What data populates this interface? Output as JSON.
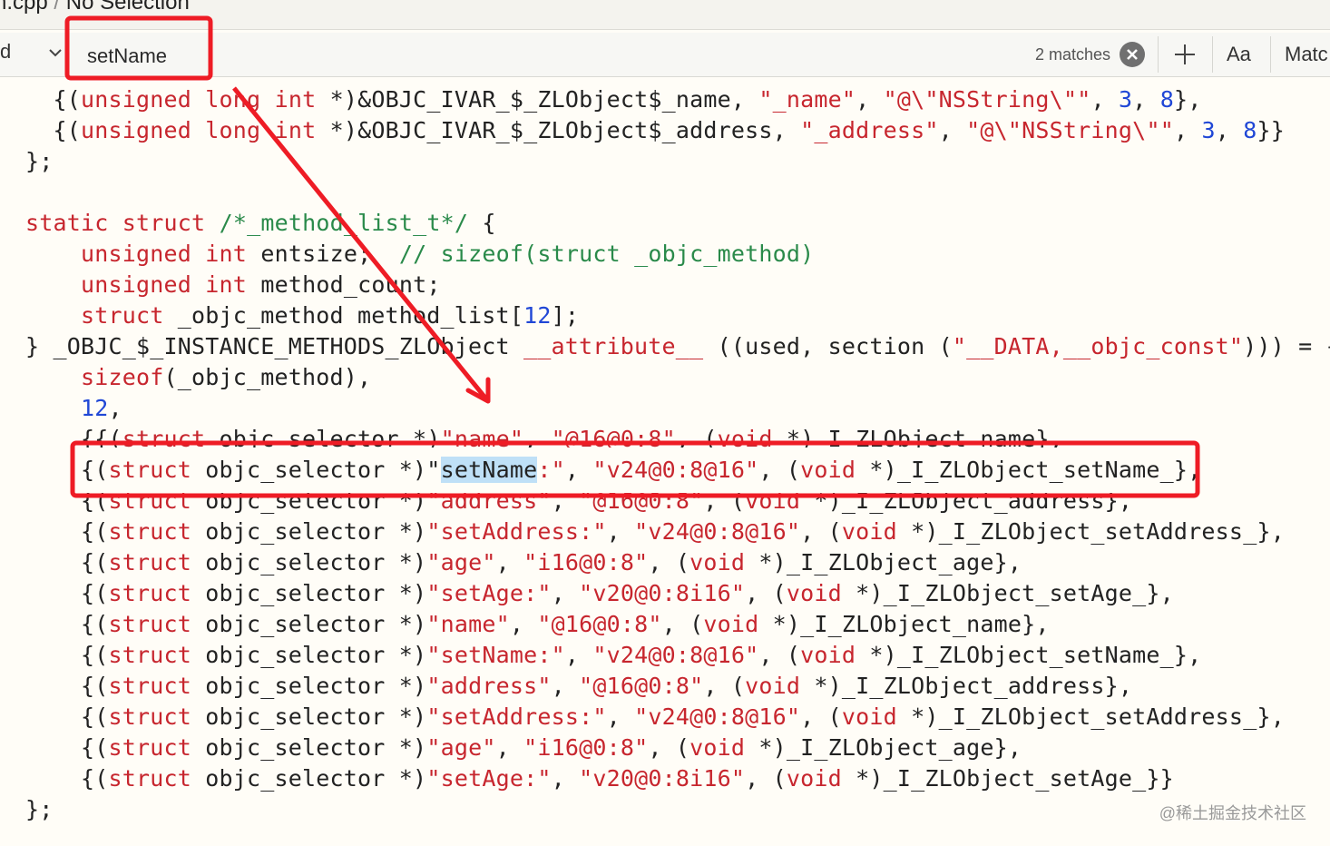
{
  "breadcrumb": {
    "file": "n.cpp",
    "separator": "/",
    "selection": "No Selection"
  },
  "find_bar": {
    "mode_label_cut": "d",
    "search_value": "setName",
    "match_count": "2 matches",
    "case_button": "Aa",
    "match_button": "Matc"
  },
  "code_lines": [
    {
      "segs": [
        [
          "p",
          "  {("
        ],
        [
          "kw",
          "unsigned"
        ],
        [
          "p",
          " "
        ],
        [
          "kw",
          "long"
        ],
        [
          "p",
          " "
        ],
        [
          "kw",
          "int"
        ],
        [
          "p",
          " *)&OBJC_IVAR_$_ZLObject$_name, "
        ],
        [
          "str",
          "\"_name\""
        ],
        [
          "p",
          ", "
        ],
        [
          "str",
          "\"@\\\"NSString\\\"\""
        ],
        [
          "p",
          ", "
        ],
        [
          "num",
          "3"
        ],
        [
          "p",
          ", "
        ],
        [
          "num",
          "8"
        ],
        [
          "p",
          "},"
        ]
      ]
    },
    {
      "segs": [
        [
          "p",
          "  {("
        ],
        [
          "kw",
          "unsigned"
        ],
        [
          "p",
          " "
        ],
        [
          "kw",
          "long"
        ],
        [
          "p",
          " "
        ],
        [
          "kw",
          "int"
        ],
        [
          "p",
          " *)&OBJC_IVAR_$_ZLObject$_address, "
        ],
        [
          "str",
          "\"_address\""
        ],
        [
          "p",
          ", "
        ],
        [
          "str",
          "\"@\\\"NSString\\\"\""
        ],
        [
          "p",
          ", "
        ],
        [
          "num",
          "3"
        ],
        [
          "p",
          ", "
        ],
        [
          "num",
          "8"
        ],
        [
          "p",
          "}}"
        ]
      ]
    },
    {
      "segs": [
        [
          "p",
          "};"
        ]
      ]
    },
    {
      "segs": [
        [
          "p",
          ""
        ]
      ]
    },
    {
      "segs": [
        [
          "kw",
          "static"
        ],
        [
          "p",
          " "
        ],
        [
          "kw",
          "struct"
        ],
        [
          "p",
          " "
        ],
        [
          "cm",
          "/*_method_list_t*/"
        ],
        [
          "p",
          " {"
        ]
      ]
    },
    {
      "segs": [
        [
          "p",
          "    "
        ],
        [
          "kw",
          "unsigned"
        ],
        [
          "p",
          " "
        ],
        [
          "kw",
          "int"
        ],
        [
          "p",
          " entsize;  "
        ],
        [
          "cm",
          "// sizeof(struct _objc_method)"
        ]
      ]
    },
    {
      "segs": [
        [
          "p",
          "    "
        ],
        [
          "kw",
          "unsigned"
        ],
        [
          "p",
          " "
        ],
        [
          "kw",
          "int"
        ],
        [
          "p",
          " method_count;"
        ]
      ]
    },
    {
      "segs": [
        [
          "p",
          "    "
        ],
        [
          "kw",
          "struct"
        ],
        [
          "p",
          " _objc_method method_list["
        ],
        [
          "num",
          "12"
        ],
        [
          "p",
          "];"
        ]
      ]
    },
    {
      "segs": [
        [
          "p",
          "} _OBJC_$_INSTANCE_METHODS_ZLObject "
        ],
        [
          "kw",
          "__attribute__"
        ],
        [
          "p",
          " ((used, section ("
        ],
        [
          "str",
          "\"__DATA,__objc_const\""
        ],
        [
          "p",
          "))) = {"
        ]
      ]
    },
    {
      "segs": [
        [
          "p",
          "    "
        ],
        [
          "kw",
          "sizeof"
        ],
        [
          "p",
          "(_objc_method),"
        ]
      ]
    },
    {
      "segs": [
        [
          "p",
          "    "
        ],
        [
          "num",
          "12"
        ],
        [
          "p",
          ","
        ]
      ]
    },
    {
      "segs": [
        [
          "p",
          "    {{("
        ],
        [
          "kw",
          "struct"
        ],
        [
          "p",
          " objc_selector *)"
        ],
        [
          "str",
          "\"name\""
        ],
        [
          "p",
          ", "
        ],
        [
          "str",
          "\"@16@0:8\""
        ],
        [
          "p",
          ", ("
        ],
        [
          "kw",
          "void"
        ],
        [
          "p",
          " *)_I_ZLObject_name},"
        ]
      ]
    },
    {
      "segs": [
        [
          "p",
          "    {("
        ],
        [
          "kw",
          "struct"
        ],
        [
          "p",
          " objc_selector *)\""
        ],
        [
          "hl",
          "setName"
        ],
        [
          "str",
          ":\""
        ],
        [
          "p",
          ", "
        ],
        [
          "str",
          "\"v24@0:8@16\""
        ],
        [
          "p",
          ", ("
        ],
        [
          "kw",
          "void"
        ],
        [
          "p",
          " *)_I_ZLObject_setName_},"
        ]
      ]
    },
    {
      "segs": [
        [
          "p",
          "    {("
        ],
        [
          "kw",
          "struct"
        ],
        [
          "p",
          " objc_selector *)"
        ],
        [
          "str",
          "\"address\""
        ],
        [
          "p",
          ", "
        ],
        [
          "str",
          "\"@16@0:8\""
        ],
        [
          "p",
          ", ("
        ],
        [
          "kw",
          "void"
        ],
        [
          "p",
          " *)_I_ZLObject_address},"
        ]
      ]
    },
    {
      "segs": [
        [
          "p",
          "    {("
        ],
        [
          "kw",
          "struct"
        ],
        [
          "p",
          " objc_selector *)"
        ],
        [
          "str",
          "\"setAddress:\""
        ],
        [
          "p",
          ", "
        ],
        [
          "str",
          "\"v24@0:8@16\""
        ],
        [
          "p",
          ", ("
        ],
        [
          "kw",
          "void"
        ],
        [
          "p",
          " *)_I_ZLObject_setAddress_},"
        ]
      ]
    },
    {
      "segs": [
        [
          "p",
          "    {("
        ],
        [
          "kw",
          "struct"
        ],
        [
          "p",
          " objc_selector *)"
        ],
        [
          "str",
          "\"age\""
        ],
        [
          "p",
          ", "
        ],
        [
          "str",
          "\"i16@0:8\""
        ],
        [
          "p",
          ", ("
        ],
        [
          "kw",
          "void"
        ],
        [
          "p",
          " *)_I_ZLObject_age},"
        ]
      ]
    },
    {
      "segs": [
        [
          "p",
          "    {("
        ],
        [
          "kw",
          "struct"
        ],
        [
          "p",
          " objc_selector *)"
        ],
        [
          "str",
          "\"setAge:\""
        ],
        [
          "p",
          ", "
        ],
        [
          "str",
          "\"v20@0:8i16\""
        ],
        [
          "p",
          ", ("
        ],
        [
          "kw",
          "void"
        ],
        [
          "p",
          " *)_I_ZLObject_setAge_},"
        ]
      ]
    },
    {
      "segs": [
        [
          "p",
          "    {("
        ],
        [
          "kw",
          "struct"
        ],
        [
          "p",
          " objc_selector *)"
        ],
        [
          "str",
          "\"name\""
        ],
        [
          "p",
          ", "
        ],
        [
          "str",
          "\"@16@0:8\""
        ],
        [
          "p",
          ", ("
        ],
        [
          "kw",
          "void"
        ],
        [
          "p",
          " *)_I_ZLObject_name},"
        ]
      ]
    },
    {
      "segs": [
        [
          "p",
          "    {("
        ],
        [
          "kw",
          "struct"
        ],
        [
          "p",
          " objc_selector *)"
        ],
        [
          "str",
          "\"setName:\""
        ],
        [
          "p",
          ", "
        ],
        [
          "str",
          "\"v24@0:8@16\""
        ],
        [
          "p",
          ", ("
        ],
        [
          "kw",
          "void"
        ],
        [
          "p",
          " *)_I_ZLObject_setName_},"
        ]
      ]
    },
    {
      "segs": [
        [
          "p",
          "    {("
        ],
        [
          "kw",
          "struct"
        ],
        [
          "p",
          " objc_selector *)"
        ],
        [
          "str",
          "\"address\""
        ],
        [
          "p",
          ", "
        ],
        [
          "str",
          "\"@16@0:8\""
        ],
        [
          "p",
          ", ("
        ],
        [
          "kw",
          "void"
        ],
        [
          "p",
          " *)_I_ZLObject_address},"
        ]
      ]
    },
    {
      "segs": [
        [
          "p",
          "    {("
        ],
        [
          "kw",
          "struct"
        ],
        [
          "p",
          " objc_selector *)"
        ],
        [
          "str",
          "\"setAddress:\""
        ],
        [
          "p",
          ", "
        ],
        [
          "str",
          "\"v24@0:8@16\""
        ],
        [
          "p",
          ", ("
        ],
        [
          "kw",
          "void"
        ],
        [
          "p",
          " *)_I_ZLObject_setAddress_},"
        ]
      ]
    },
    {
      "segs": [
        [
          "p",
          "    {("
        ],
        [
          "kw",
          "struct"
        ],
        [
          "p",
          " objc_selector *)"
        ],
        [
          "str",
          "\"age\""
        ],
        [
          "p",
          ", "
        ],
        [
          "str",
          "\"i16@0:8\""
        ],
        [
          "p",
          ", ("
        ],
        [
          "kw",
          "void"
        ],
        [
          "p",
          " *)_I_ZLObject_age},"
        ]
      ]
    },
    {
      "segs": [
        [
          "p",
          "    {("
        ],
        [
          "kw",
          "struct"
        ],
        [
          "p",
          " objc_selector *)"
        ],
        [
          "str",
          "\"setAge:\""
        ],
        [
          "p",
          ", "
        ],
        [
          "str",
          "\"v20@0:8i16\""
        ],
        [
          "p",
          ", ("
        ],
        [
          "kw",
          "void"
        ],
        [
          "p",
          " *)_I_ZLObject_setAge_}}"
        ]
      ]
    },
    {
      "segs": [
        [
          "p",
          "};"
        ]
      ]
    }
  ],
  "watermark": "@稀土掘金技术社区",
  "colors": {
    "keyword": "#c7262e",
    "string": "#c7262e",
    "comment": "#2a8a4a",
    "number": "#2047d6",
    "annotation": "#ee1c25",
    "match_highlight": "#bfe0f7"
  },
  "icons": [
    "chevron-down-icon",
    "clear-search-icon",
    "add-icon"
  ]
}
